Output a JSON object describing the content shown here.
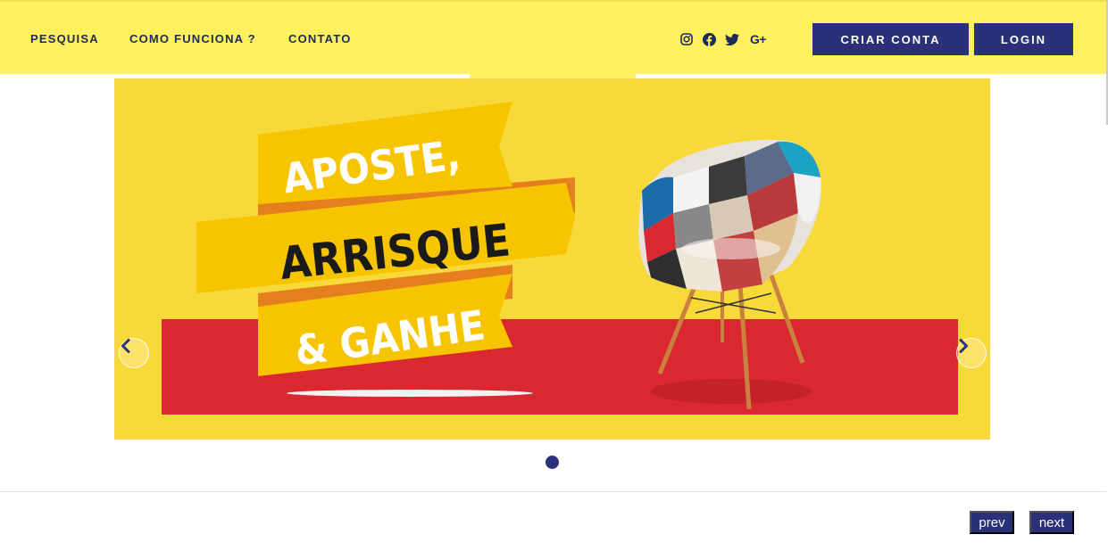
{
  "nav": {
    "items": [
      {
        "label": "PESQUISA"
      },
      {
        "label": "COMO FUNCIONA ?"
      },
      {
        "label": "CONTATO"
      }
    ]
  },
  "social": {
    "icons": [
      "instagram-icon",
      "facebook-icon",
      "twitter-icon",
      "google-plus-icon"
    ],
    "google_plus_label": "G+"
  },
  "actions": {
    "create_account_label": "CRIAR CONTA",
    "login_label": "LOGIN"
  },
  "banner": {
    "line1": "APOSTE,",
    "line2": "ARRISQUE",
    "line3": "& GANHE",
    "slide_count": 1,
    "active_slide": 1
  },
  "pagination": {
    "prev_label": "prev",
    "next_label": "next"
  },
  "colors": {
    "header_bg": "#fef05e",
    "accent": "#2b3179",
    "banner_bg": "#f8d93a",
    "banner_red": "#d9282f",
    "ribbon": "#f7c400"
  }
}
